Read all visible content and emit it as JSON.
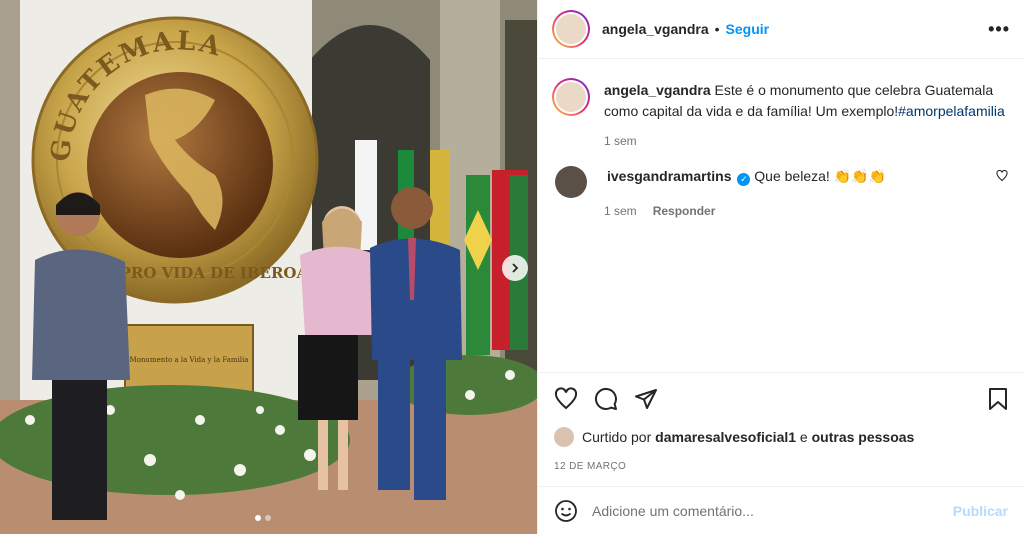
{
  "post": {
    "author": "angela_vgandra",
    "separator": "•",
    "follow_label": "Seguir",
    "more_label": "•••",
    "caption_author": "angela_vgandra",
    "caption_text": "Este é o monumento que celebra Guatemala como capital da vida e da família! Um exemplo!",
    "caption_hashtag": "#amorpelafamilia",
    "caption_time": "1 sem"
  },
  "photo": {
    "seal_top_text": "GUATEMALA",
    "seal_side_text": "CAPITAL PRO VIDA DE IBEROAMÉRICA",
    "plaque_title": "Monumento a la Vida y la Familia",
    "carousel_dots": 2,
    "active_dot": 0
  },
  "comments": [
    {
      "author": "ivesgandramartins",
      "verified": true,
      "text": "Que beleza! 👏👏👏",
      "time": "1 sem",
      "reply_label": "Responder"
    }
  ],
  "likes": {
    "prefix": "Curtido por",
    "user": "damaresalvesoficial1",
    "connector": "e",
    "others": "outras pessoas"
  },
  "date": "12 DE MARÇO",
  "add_comment": {
    "placeholder": "Adicione um comentário...",
    "publish_label": "Publicar"
  },
  "icons": {
    "like": "heart-icon",
    "comment": "comment-icon",
    "share": "share-icon",
    "save": "bookmark-icon",
    "emoji": "emoji-icon",
    "next": "chevron-right-icon"
  },
  "colors": {
    "accent": "#0095f6",
    "hashtag": "#00376b",
    "muted": "#737373",
    "publish_disabled": "#b3dbff",
    "seal_gold": "#c9a54a",
    "seal_globe": "#7a4a22"
  }
}
